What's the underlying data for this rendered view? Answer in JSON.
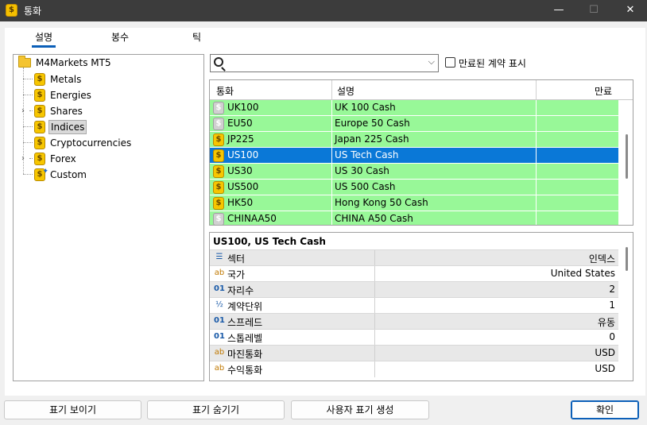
{
  "window": {
    "title": "통화"
  },
  "tabs": [
    {
      "label": "설명",
      "active": true
    },
    {
      "label": "봉수"
    },
    {
      "label": "틱"
    }
  ],
  "tree": {
    "root": "M4Markets MT5",
    "items": [
      {
        "label": "Metals"
      },
      {
        "label": "Energies"
      },
      {
        "label": "Shares",
        "expandable": true
      },
      {
        "label": "Indices",
        "selected": true
      },
      {
        "label": "Cryptocurrencies"
      },
      {
        "label": "Forex",
        "expandable": true
      },
      {
        "label": "Custom"
      }
    ]
  },
  "search": {
    "value": "",
    "placeholder": ""
  },
  "expired_checkbox": {
    "label": "만료된 계약 표시",
    "checked": false
  },
  "symbols_table": {
    "columns": [
      "통화",
      "설명",
      "만료"
    ],
    "rows": [
      {
        "symbol": "UK100",
        "description": "UK 100 Cash",
        "expiry": "",
        "icon": "grey"
      },
      {
        "symbol": "EU50",
        "description": "Europe 50 Cash",
        "expiry": "",
        "icon": "grey"
      },
      {
        "symbol": "JP225",
        "description": "Japan 225 Cash",
        "expiry": "",
        "icon": "gold"
      },
      {
        "symbol": "US100",
        "description": "US Tech Cash",
        "expiry": "",
        "icon": "gold",
        "selected": true
      },
      {
        "symbol": "US30",
        "description": "US 30 Cash",
        "expiry": "",
        "icon": "gold"
      },
      {
        "symbol": "US500",
        "description": "US 500 Cash",
        "expiry": "",
        "icon": "gold"
      },
      {
        "symbol": "HK50",
        "description": "Hong Kong 50 Cash",
        "expiry": "",
        "icon": "gold"
      },
      {
        "symbol": "CHINAA50",
        "description": "CHINA A50 Cash",
        "expiry": "",
        "icon": "grey"
      }
    ]
  },
  "properties": {
    "title": "US100, US Tech Cash",
    "rows": [
      {
        "icon": "sector-icon",
        "name": "섹터",
        "value": "인덱스"
      },
      {
        "icon": "text-icon",
        "name": "국가",
        "value": "United States"
      },
      {
        "icon": "number-icon",
        "name": "자리수",
        "value": "2"
      },
      {
        "icon": "fraction-icon",
        "name": "계약단위",
        "value": "1"
      },
      {
        "icon": "number-icon",
        "name": "스프레드",
        "value": "유동"
      },
      {
        "icon": "number-icon",
        "name": "스톱레벨",
        "value": "0"
      },
      {
        "icon": "text-icon",
        "name": "마진통화",
        "value": "USD"
      },
      {
        "icon": "text-icon",
        "name": "수익통화",
        "value": "USD"
      }
    ]
  },
  "buttons": {
    "show_symbol": "표기 보이기",
    "hide_symbol": "표기 숨기기",
    "create_custom": "사용자 표기 생성",
    "ok": "확인"
  },
  "colors": {
    "row_green": "#98f898",
    "row_selected": "#0a78d7",
    "accent": "#0b5fb8"
  }
}
